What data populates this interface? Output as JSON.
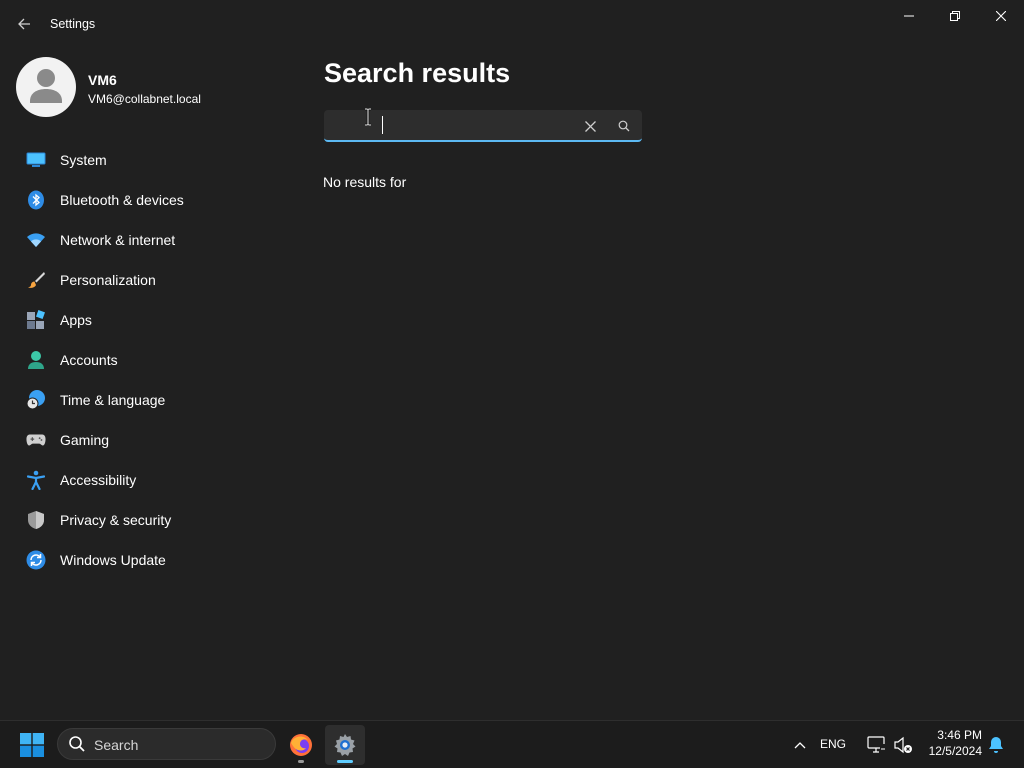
{
  "window": {
    "title": "Settings"
  },
  "profile": {
    "name": "VM6",
    "email": "VM6@collabnet.local"
  },
  "sidebar": {
    "items": [
      {
        "label": "System",
        "icon": "monitor-icon"
      },
      {
        "label": "Bluetooth & devices",
        "icon": "bluetooth-icon"
      },
      {
        "label": "Network & internet",
        "icon": "wifi-icon"
      },
      {
        "label": "Personalization",
        "icon": "brush-icon"
      },
      {
        "label": "Apps",
        "icon": "apps-icon"
      },
      {
        "label": "Accounts",
        "icon": "person-icon"
      },
      {
        "label": "Time & language",
        "icon": "globe-clock-icon"
      },
      {
        "label": "Gaming",
        "icon": "gamepad-icon"
      },
      {
        "label": "Accessibility",
        "icon": "accessibility-icon"
      },
      {
        "label": "Privacy & security",
        "icon": "shield-icon"
      },
      {
        "label": "Windows Update",
        "icon": "update-icon"
      }
    ]
  },
  "main": {
    "title": "Search results",
    "search": {
      "value": "",
      "placeholder": ""
    },
    "no_results": "No results for"
  },
  "taskbar": {
    "search_label": "Search",
    "apps": [
      "firefox-icon",
      "settings-gear-icon"
    ],
    "tray": {
      "language": "ENG",
      "time": "3:46 PM",
      "date": "12/5/2024"
    }
  },
  "colors": {
    "background": "#202020",
    "accent": "#60cdff",
    "taskbar": "#1c1c1c"
  }
}
